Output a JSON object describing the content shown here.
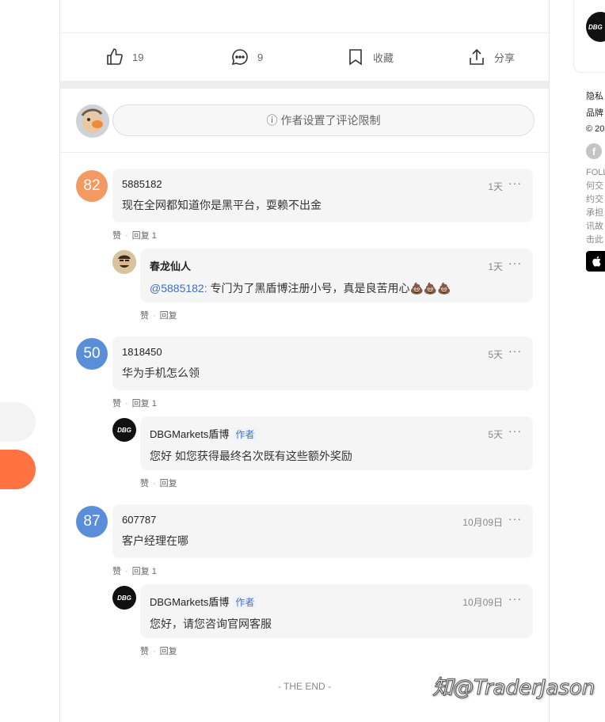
{
  "colors": {
    "orange_avatar": "#f39a62",
    "blue_avatar": "#5b8ed8",
    "accent_orange": "#ff7342",
    "mention_blue": "#3d6fc6"
  },
  "actions": {
    "like": {
      "icon": "thumbs-up-icon",
      "count": "19"
    },
    "comment": {
      "icon": "comment-icon",
      "count": "9"
    },
    "bookmark": {
      "icon": "bookmark-icon",
      "label": "收藏"
    },
    "share": {
      "icon": "share-icon",
      "label": "分享"
    }
  },
  "restriction": {
    "icon": "info-icon",
    "glyph": "ⓘ",
    "text": "作者设置了评论限制"
  },
  "comments": [
    {
      "avatar_text": "82",
      "avatar_color": "#f39a62",
      "user": "5885182",
      "time": "1天",
      "text": "现在全网都知道你是黑平台，耍赖不出金",
      "like_label": "赞",
      "reply_label": "回复 1",
      "reply": {
        "user": "春龙仙人",
        "time": "1天",
        "mention": "@5885182:",
        "text": " 专门为了黑盾博注册小号，真是良苦用心💩💩💩",
        "like_label": "赞",
        "reply_label": "回复"
      }
    },
    {
      "avatar_text": "50",
      "avatar_color": "#5b8ed8",
      "user": "1818450",
      "time": "5天",
      "text": "华为手机怎么领",
      "like_label": "赞",
      "reply_label": "回复 1",
      "reply": {
        "user": "DBGMarkets盾博",
        "tag": "作者",
        "time": "5天",
        "text": "您好 如您获得最终名次既有这些额外奖励",
        "like_label": "赞",
        "reply_label": "回复"
      }
    },
    {
      "avatar_text": "87",
      "avatar_color": "#5b8ed8",
      "user": "607787",
      "time": "10月09日",
      "text": "客户经理在哪",
      "like_label": "赞",
      "reply_label": "回复 1",
      "reply": {
        "user": "DBGMarkets盾博",
        "tag": "作者",
        "time": "10月09日",
        "text": "您好，请您咨询官网客服",
        "like_label": "赞",
        "reply_label": "回复"
      }
    }
  ],
  "more_glyph": "···",
  "the_end": "- THE END -",
  "sidebar": {
    "logo_text": "DBG",
    "links": [
      "隐私",
      "品牌",
      "© 20"
    ],
    "facebook_glyph": "f",
    "follow_lines": [
      "FOLL",
      "何交",
      "约交",
      "承担",
      "讯故",
      "击此"
    ],
    "apple_glyph": ""
  },
  "watermark": "知@TraderJason"
}
